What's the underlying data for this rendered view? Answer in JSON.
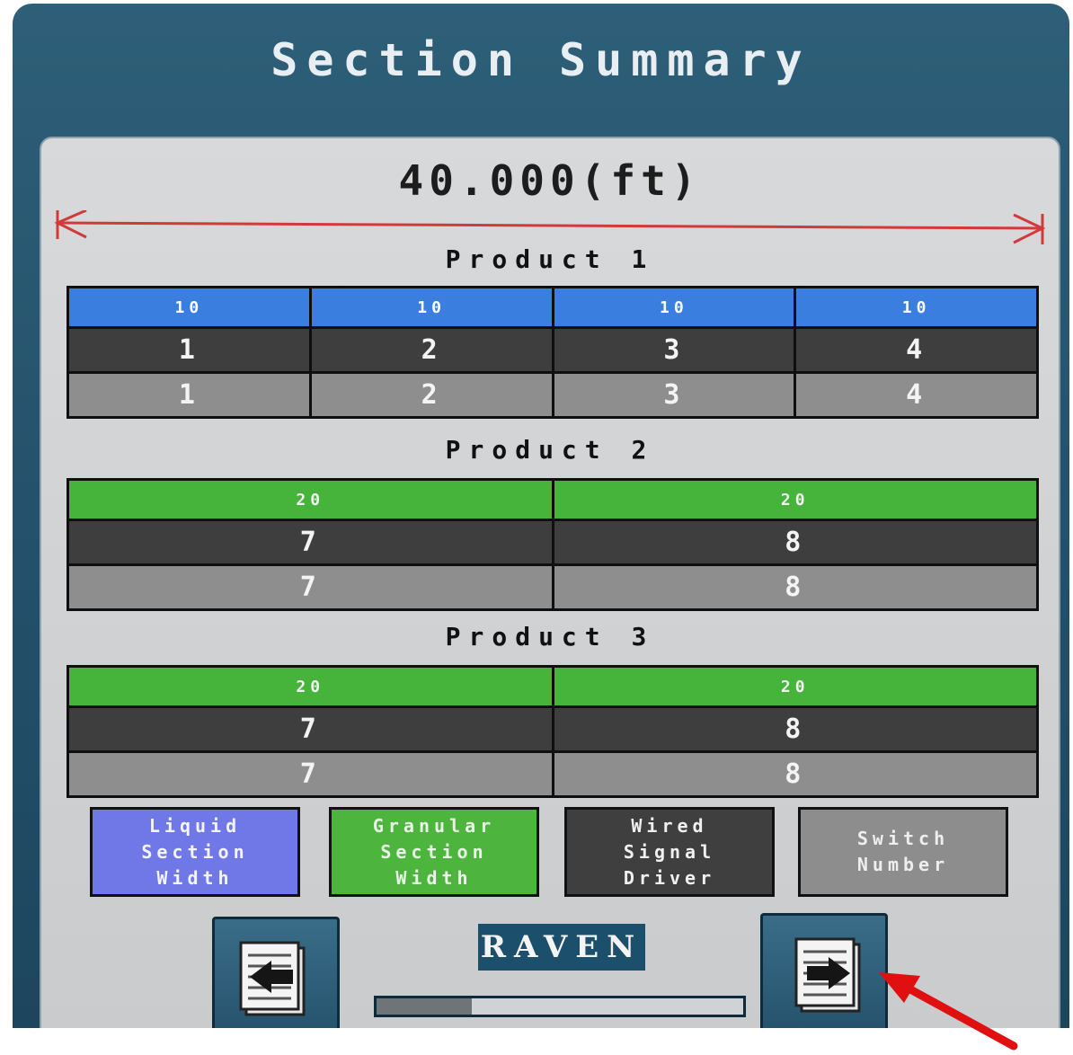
{
  "screen": {
    "title": "Section Summary",
    "total_width": "40.000(ft)"
  },
  "products": [
    {
      "label": "Product 1",
      "type": "liquid",
      "widths": [
        "10",
        "10",
        "10",
        "10"
      ],
      "wired": [
        "1",
        "2",
        "3",
        "4"
      ],
      "switch": [
        "1",
        "2",
        "3",
        "4"
      ]
    },
    {
      "label": "Product 2",
      "type": "granular",
      "widths": [
        "20",
        "20"
      ],
      "wired": [
        "7",
        "8"
      ],
      "switch": [
        "7",
        "8"
      ]
    },
    {
      "label": "Product 3",
      "type": "granular",
      "widths": [
        "20",
        "20"
      ],
      "wired": [
        "7",
        "8"
      ],
      "switch": [
        "7",
        "8"
      ]
    }
  ],
  "legend": {
    "liquid": "Liquid\nSection\nWidth",
    "granular": "Granular\nSection\nWidth",
    "wired": "Wired\nSignal\nDriver",
    "switch": "Switch\nNumber"
  },
  "footer": {
    "brand": "RAVEN",
    "progress": 0.26
  },
  "colors": {
    "liquid": "#3a7fe0",
    "granular": "#46b33a",
    "wired": "#3e3e3e",
    "switch": "#8e8e8e",
    "measure_line": "#d23a3a",
    "annotation_arrow": "#e01010"
  },
  "icons": {
    "prev_page": "page-left-arrow-icon",
    "next_page": "page-right-arrow-icon"
  }
}
